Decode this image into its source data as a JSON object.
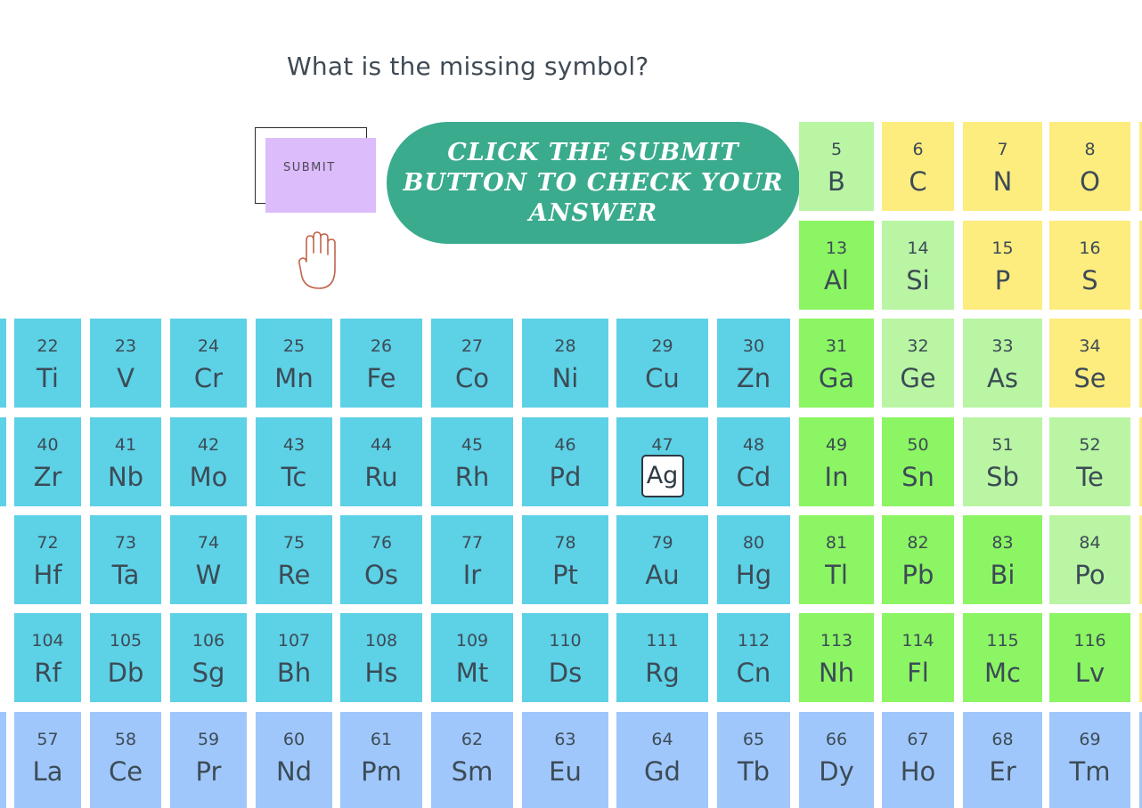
{
  "question": "What is the missing symbol?",
  "submit_label": "SUBMIT",
  "tip_text": "CLICK THE SUBMIT BUTTON TO CHECK YOUR ANSWER",
  "answer_value": "Ag",
  "colors": {
    "transition_metal": "#5dd1e6",
    "lanthanide": "#a0c7fb",
    "post_transition": "#8cf563",
    "metalloid": "#b9f5a3",
    "nonmetal": "#fdec7e",
    "submit_bg": "#dcbcfa",
    "tip_bg": "#3bab8e"
  },
  "elements": [
    {
      "num": "5",
      "sym": "B",
      "cat": "metalloid"
    },
    {
      "num": "6",
      "sym": "C",
      "cat": "nonmetal"
    },
    {
      "num": "7",
      "sym": "N",
      "cat": "nonmetal"
    },
    {
      "num": "8",
      "sym": "O",
      "cat": "nonmetal"
    },
    {
      "num": "13",
      "sym": "Al",
      "cat": "post_transition"
    },
    {
      "num": "14",
      "sym": "Si",
      "cat": "metalloid"
    },
    {
      "num": "15",
      "sym": "P",
      "cat": "nonmetal"
    },
    {
      "num": "16",
      "sym": "S",
      "cat": "nonmetal"
    },
    {
      "num": "22",
      "sym": "Ti",
      "cat": "transition_metal"
    },
    {
      "num": "23",
      "sym": "V",
      "cat": "transition_metal"
    },
    {
      "num": "24",
      "sym": "Cr",
      "cat": "transition_metal"
    },
    {
      "num": "25",
      "sym": "Mn",
      "cat": "transition_metal"
    },
    {
      "num": "26",
      "sym": "Fe",
      "cat": "transition_metal"
    },
    {
      "num": "27",
      "sym": "Co",
      "cat": "transition_metal"
    },
    {
      "num": "28",
      "sym": "Ni",
      "cat": "transition_metal"
    },
    {
      "num": "29",
      "sym": "Cu",
      "cat": "transition_metal"
    },
    {
      "num": "30",
      "sym": "Zn",
      "cat": "transition_metal"
    },
    {
      "num": "31",
      "sym": "Ga",
      "cat": "post_transition"
    },
    {
      "num": "32",
      "sym": "Ge",
      "cat": "metalloid"
    },
    {
      "num": "33",
      "sym": "As",
      "cat": "metalloid"
    },
    {
      "num": "34",
      "sym": "Se",
      "cat": "nonmetal"
    },
    {
      "num": "40",
      "sym": "Zr",
      "cat": "transition_metal"
    },
    {
      "num": "41",
      "sym": "Nb",
      "cat": "transition_metal"
    },
    {
      "num": "42",
      "sym": "Mo",
      "cat": "transition_metal"
    },
    {
      "num": "43",
      "sym": "Tc",
      "cat": "transition_metal"
    },
    {
      "num": "44",
      "sym": "Ru",
      "cat": "transition_metal"
    },
    {
      "num": "45",
      "sym": "Rh",
      "cat": "transition_metal"
    },
    {
      "num": "46",
      "sym": "Pd",
      "cat": "transition_metal"
    },
    {
      "num": "47",
      "sym": "",
      "cat": "transition_metal",
      "input": true
    },
    {
      "num": "48",
      "sym": "Cd",
      "cat": "transition_metal"
    },
    {
      "num": "49",
      "sym": "In",
      "cat": "post_transition"
    },
    {
      "num": "50",
      "sym": "Sn",
      "cat": "post_transition"
    },
    {
      "num": "51",
      "sym": "Sb",
      "cat": "metalloid"
    },
    {
      "num": "52",
      "sym": "Te",
      "cat": "metalloid"
    },
    {
      "num": "72",
      "sym": "Hf",
      "cat": "transition_metal"
    },
    {
      "num": "73",
      "sym": "Ta",
      "cat": "transition_metal"
    },
    {
      "num": "74",
      "sym": "W",
      "cat": "transition_metal"
    },
    {
      "num": "75",
      "sym": "Re",
      "cat": "transition_metal"
    },
    {
      "num": "76",
      "sym": "Os",
      "cat": "transition_metal"
    },
    {
      "num": "77",
      "sym": "Ir",
      "cat": "transition_metal"
    },
    {
      "num": "78",
      "sym": "Pt",
      "cat": "transition_metal"
    },
    {
      "num": "79",
      "sym": "Au",
      "cat": "transition_metal"
    },
    {
      "num": "80",
      "sym": "Hg",
      "cat": "transition_metal"
    },
    {
      "num": "81",
      "sym": "Tl",
      "cat": "post_transition"
    },
    {
      "num": "82",
      "sym": "Pb",
      "cat": "post_transition"
    },
    {
      "num": "83",
      "sym": "Bi",
      "cat": "post_transition"
    },
    {
      "num": "84",
      "sym": "Po",
      "cat": "metalloid"
    },
    {
      "num": "104",
      "sym": "Rf",
      "cat": "transition_metal"
    },
    {
      "num": "105",
      "sym": "Db",
      "cat": "transition_metal"
    },
    {
      "num": "106",
      "sym": "Sg",
      "cat": "transition_metal"
    },
    {
      "num": "107",
      "sym": "Bh",
      "cat": "transition_metal"
    },
    {
      "num": "108",
      "sym": "Hs",
      "cat": "transition_metal"
    },
    {
      "num": "109",
      "sym": "Mt",
      "cat": "transition_metal"
    },
    {
      "num": "110",
      "sym": "Ds",
      "cat": "transition_metal"
    },
    {
      "num": "111",
      "sym": "Rg",
      "cat": "transition_metal"
    },
    {
      "num": "112",
      "sym": "Cn",
      "cat": "transition_metal"
    },
    {
      "num": "113",
      "sym": "Nh",
      "cat": "post_transition"
    },
    {
      "num": "114",
      "sym": "Fl",
      "cat": "post_transition"
    },
    {
      "num": "115",
      "sym": "Mc",
      "cat": "post_transition"
    },
    {
      "num": "116",
      "sym": "Lv",
      "cat": "post_transition"
    },
    {
      "num": "57",
      "sym": "La",
      "cat": "lanthanide"
    },
    {
      "num": "58",
      "sym": "Ce",
      "cat": "lanthanide"
    },
    {
      "num": "59",
      "sym": "Pr",
      "cat": "lanthanide"
    },
    {
      "num": "60",
      "sym": "Nd",
      "cat": "lanthanide"
    },
    {
      "num": "61",
      "sym": "Pm",
      "cat": "lanthanide"
    },
    {
      "num": "62",
      "sym": "Sm",
      "cat": "lanthanide"
    },
    {
      "num": "63",
      "sym": "Eu",
      "cat": "lanthanide"
    },
    {
      "num": "64",
      "sym": "Gd",
      "cat": "lanthanide"
    },
    {
      "num": "65",
      "sym": "Tb",
      "cat": "lanthanide"
    },
    {
      "num": "66",
      "sym": "Dy",
      "cat": "lanthanide"
    },
    {
      "num": "67",
      "sym": "Ho",
      "cat": "lanthanide"
    },
    {
      "num": "68",
      "sym": "Er",
      "cat": "lanthanide"
    },
    {
      "num": "69",
      "sym": "Tm",
      "cat": "lanthanide"
    }
  ]
}
